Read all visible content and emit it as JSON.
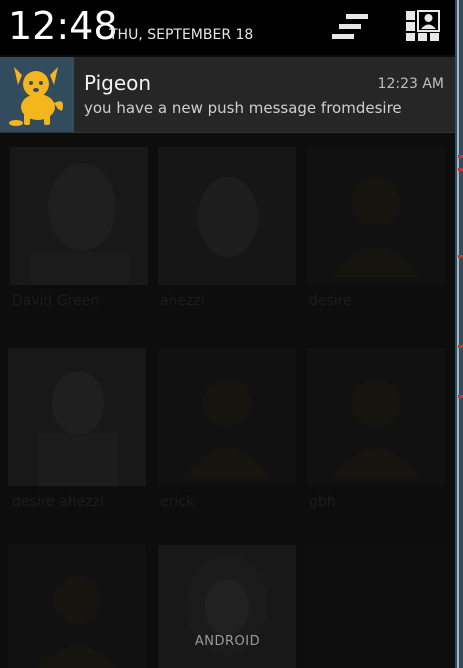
{
  "status": {
    "clock": "12:48",
    "date": "THU, SEPTEMBER 18"
  },
  "icons": {
    "quick_toggle": "quick-settings-toggle-icon",
    "settings": "user-settings-icon",
    "app": "pigeon-dog-icon"
  },
  "notification": {
    "title": "Pigeon",
    "time": "12:23 AM",
    "text": "you have a new push message fromdesire"
  },
  "contacts": [
    {
      "name": "David Green"
    },
    {
      "name": "ahezzi"
    },
    {
      "name": "desire"
    },
    {
      "name": "desire ahezzi"
    },
    {
      "name": "erick"
    },
    {
      "name": "gbh"
    }
  ],
  "carrier": "ANDROID",
  "colors": {
    "shade_header": "#000000",
    "notification_bg": "#262626",
    "app_icon_bg": "#324c5e",
    "app_icon_fg": "#f5b51c"
  }
}
